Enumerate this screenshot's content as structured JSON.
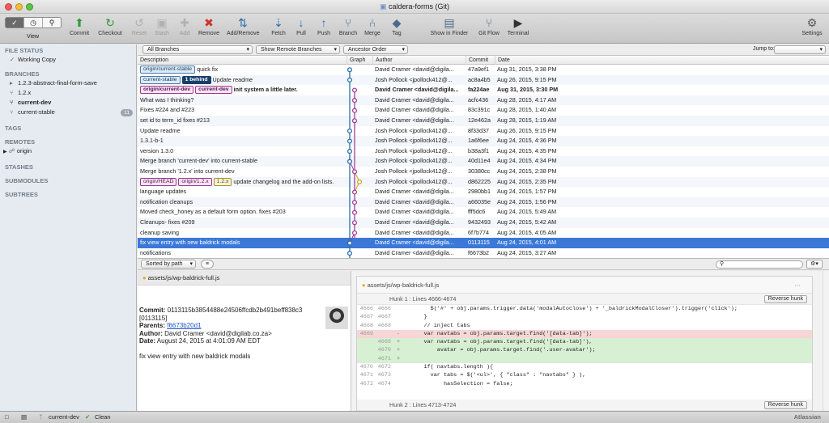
{
  "window": {
    "title": "caldera-forms (Git)"
  },
  "toolbar": {
    "view_label": "View",
    "buttons": [
      {
        "label": "Commit",
        "icon": "commit-icon",
        "enabled": true
      },
      {
        "label": "Checkout",
        "icon": "checkout-icon",
        "enabled": true
      },
      {
        "label": "Reset",
        "icon": "reset-icon",
        "enabled": false
      },
      {
        "label": "Stash",
        "icon": "stash-icon",
        "enabled": false
      },
      {
        "label": "Add",
        "icon": "add-icon",
        "enabled": false
      },
      {
        "label": "Remove",
        "icon": "remove-icon",
        "enabled": true
      },
      {
        "label": "Add/Remove",
        "icon": "add-remove-icon",
        "enabled": true
      },
      {
        "label": "Fetch",
        "icon": "fetch-icon",
        "enabled": true
      },
      {
        "label": "Pull",
        "icon": "pull-icon",
        "enabled": true
      },
      {
        "label": "Push",
        "icon": "push-icon",
        "enabled": true
      },
      {
        "label": "Branch",
        "icon": "branch-icon",
        "enabled": true
      },
      {
        "label": "Merge",
        "icon": "merge-icon",
        "enabled": true
      },
      {
        "label": "Tag",
        "icon": "tag-icon",
        "enabled": true
      },
      {
        "label": "Show in Finder",
        "icon": "finder-icon",
        "enabled": true
      },
      {
        "label": "Git Flow",
        "icon": "git-flow-icon",
        "enabled": true
      },
      {
        "label": "Terminal",
        "icon": "terminal-icon",
        "enabled": true
      }
    ],
    "settings_label": "Settings"
  },
  "sidebar": {
    "file_status": "FILE STATUS",
    "working_copy": "Working Copy",
    "branches_header": "BRANCHES",
    "branches": [
      {
        "label": "1.2.3-abstract-final-form-save",
        "current": false,
        "count": ""
      },
      {
        "label": "1.2.x",
        "current": false,
        "count": ""
      },
      {
        "label": "current-dev",
        "current": true,
        "count": ""
      },
      {
        "label": "current-stable",
        "current": false,
        "count": "11"
      }
    ],
    "tags_header": "TAGS",
    "remotes_header": "REMOTES",
    "remote": "origin",
    "stashes_header": "STASHES",
    "submodules_header": "SUBMODULES",
    "subtrees_header": "SUBTREES"
  },
  "filters": {
    "branches": "All Branches",
    "remote_branches": "Show Remote Branches",
    "order": "Ancestor Order",
    "jump_to": "Jump to:"
  },
  "columns": {
    "description": "Description",
    "graph": "Graph",
    "author": "Author",
    "commit": "Commit",
    "date": "Date"
  },
  "commits": [
    {
      "tags": [
        {
          "t": "origin/current-stable",
          "k": "rm"
        }
      ],
      "msg": "quick fix",
      "author": "David Cramer <david@digila...",
      "hash": "47a9ef1",
      "date": "Aug 31, 2015, 3:38 PM",
      "bold": false,
      "sel": false
    },
    {
      "tags": [
        {
          "t": "current-stable",
          "k": "rm"
        },
        {
          "t": "1 behind",
          "k": "ahead"
        }
      ],
      "msg": "Update readme",
      "author": "Josh Pollock <jpollock412@...",
      "hash": "ac8a4b5",
      "date": "Aug 26, 2015, 9:15 PM",
      "bold": false,
      "sel": false
    },
    {
      "tags": [
        {
          "t": "origin/current-dev",
          "k": "lc"
        },
        {
          "t": "current-dev",
          "k": "lc"
        }
      ],
      "msg": "init system a little later.",
      "author": "David Cramer <david@digila...",
      "hash": "fa224ae",
      "date": "Aug 31, 2015, 3:30 PM",
      "bold": true,
      "sel": false
    },
    {
      "tags": [],
      "msg": "What was I thinking?",
      "author": "David Cramer <david@digila...",
      "hash": "acfc436",
      "date": "Aug 28, 2015, 4:17 AM",
      "bold": false,
      "sel": false
    },
    {
      "tags": [],
      "msg": "Fixes #224 and #223",
      "author": "David Cramer <david@digila...",
      "hash": "83c391c",
      "date": "Aug 28, 2015, 1:40 AM",
      "bold": false,
      "sel": false
    },
    {
      "tags": [],
      "msg": "set id to term_id fixes #213",
      "author": "David Cramer <david@digila...",
      "hash": "12e462a",
      "date": "Aug 28, 2015, 1:19 AM",
      "bold": false,
      "sel": false
    },
    {
      "tags": [],
      "msg": "Update readme",
      "author": "Josh Pollock <jpollock412@...",
      "hash": "8f33d37",
      "date": "Aug 26, 2015, 9:15 PM",
      "bold": false,
      "sel": false
    },
    {
      "tags": [],
      "msg": "1.3.1-b-1",
      "author": "Josh Pollock <jpollock412@...",
      "hash": "1a6f6ee",
      "date": "Aug 24, 2015, 4:36 PM",
      "bold": false,
      "sel": false
    },
    {
      "tags": [],
      "msg": "version 1.3.0",
      "author": "Josh Pollock <jpollock412@...",
      "hash": "b38a3f1",
      "date": "Aug 24, 2015, 4:35 PM",
      "bold": false,
      "sel": false
    },
    {
      "tags": [],
      "msg": "Merge branch 'current-dev' into current-stable",
      "author": "Josh Pollock <jpollock412@...",
      "hash": "40d11e4",
      "date": "Aug 24, 2015, 4:34 PM",
      "bold": false,
      "sel": false
    },
    {
      "tags": [],
      "msg": "Merge branch '1.2.x' into current-dev",
      "author": "Josh Pollock <jpollock412@...",
      "hash": "30380cc",
      "date": "Aug 24, 2015, 2:38 PM",
      "bold": false,
      "sel": false
    },
    {
      "tags": [
        {
          "t": "origin/HEAD",
          "k": "lc"
        },
        {
          "t": "origin/1.2.x",
          "k": "lc"
        },
        {
          "t": "1.2.x",
          "k": "tg"
        }
      ],
      "msg": "update changelog and the add-on lists.",
      "author": "Josh Pollock <jpollock412@...",
      "hash": "d862225",
      "date": "Aug 24, 2015, 2:35 PM",
      "bold": false,
      "sel": false
    },
    {
      "tags": [],
      "msg": "language updates",
      "author": "David Cramer <david@digila...",
      "hash": "2980bb1",
      "date": "Aug 24, 2015, 1:57 PM",
      "bold": false,
      "sel": false
    },
    {
      "tags": [],
      "msg": "notification cleanups",
      "author": "David Cramer <david@digila...",
      "hash": "a66035e",
      "date": "Aug 24, 2015, 1:56 PM",
      "bold": false,
      "sel": false
    },
    {
      "tags": [],
      "msg": "Moved check_honey as a default form option. fixes #203",
      "author": "David Cramer <david@digila...",
      "hash": "fff5dc6",
      "date": "Aug 24, 2015, 5:49 AM",
      "bold": false,
      "sel": false
    },
    {
      "tags": [],
      "msg": "Cleanups- fixes #209",
      "author": "David Cramer <david@digila...",
      "hash": "9432493",
      "date": "Aug 24, 2015, 5:42 AM",
      "bold": false,
      "sel": false
    },
    {
      "tags": [],
      "msg": "cleanup saving",
      "author": "David Cramer <david@digila...",
      "hash": "6f7b774",
      "date": "Aug 24, 2015, 4:05 AM",
      "bold": false,
      "sel": false
    },
    {
      "tags": [],
      "msg": "fix view entry with new baldrick modals",
      "author": "David Cramer <david@digila...",
      "hash": "0113115",
      "date": "Aug 24, 2015, 4:01 AM",
      "bold": false,
      "sel": true
    },
    {
      "tags": [],
      "msg": "notifications",
      "author": "David Cramer <david@digila...",
      "hash": "f6673b2",
      "date": "Aug 24, 2015, 3:27 AM",
      "bold": false,
      "sel": false
    }
  ],
  "lower": {
    "sorted": "Sorted by path"
  },
  "files": [
    {
      "path": "assets/js/wp-baldrick-full.js"
    }
  ],
  "commit_detail": {
    "commit_label": "Commit:",
    "commit_value": "0113115b3854488e24506ffcdb2b491beff838c3 [0113115]",
    "parents_label": "Parents:",
    "parents_value": "f6673b20d1",
    "author_label": "Author:",
    "author_value": "David Cramer <david@digilab.co.za>",
    "date_label": "Date:",
    "date_value": "August 24, 2015 at 4:01:09 AM EDT",
    "message": "fix view entry with new baldrick modals"
  },
  "diff": {
    "file": "assets/js/wp-baldrick-full.js",
    "reverse_label": "Reverse hunk",
    "hunk1": "Hunk 1 : Lines 4666-4674",
    "hunk2": "Hunk 2 : Lines 4713-4724",
    "lines": [
      {
        "o": "4666",
        "n": "4666",
        "m": "",
        "k": "ctx",
        "code": "        $('#' + obj.params.trigger.data('modalAutoclose') + '_baldrickModalCloser').trigger('click');"
      },
      {
        "o": "4667",
        "n": "4667",
        "m": "",
        "k": "ctx",
        "code": "      }"
      },
      {
        "o": "4668",
        "n": "4668",
        "m": "",
        "k": "ctx",
        "code": "      // inject tabs"
      },
      {
        "o": "4669",
        "n": "",
        "m": "-",
        "k": "del",
        "code": "      var navtabs = obj.params.target.find('[data-tab]');"
      },
      {
        "o": "",
        "n": "4669",
        "m": "+",
        "k": "add",
        "code": "      var navtabs = obj.params.target.find('[data-tab]'),"
      },
      {
        "o": "",
        "n": "4670",
        "m": "+",
        "k": "add",
        "code": "          avatar = obj.params.target.find('.user-avatar');"
      },
      {
        "o": "",
        "n": "4671",
        "m": "+",
        "k": "add",
        "code": ""
      },
      {
        "o": "4670",
        "n": "4672",
        "m": "",
        "k": "ctx",
        "code": "      if( navtabs.length ){"
      },
      {
        "o": "4671",
        "n": "4673",
        "m": "",
        "k": "ctx",
        "code": "        var tabs = $('<ul>', { \"class\" : \"navtabs\" } ),"
      },
      {
        "o": "4672",
        "n": "4674",
        "m": "",
        "k": "ctx",
        "code": "            hasSelection = false;"
      }
    ]
  },
  "status": {
    "branch": "current-dev",
    "state": "Clean",
    "brand": "Atlassian"
  },
  "colors": {
    "selected": "#3b78d8",
    "remote": "#4a7aa6",
    "local": "#a33593",
    "tag": "#a79438"
  },
  "graph": {
    "lanes": [
      "#2b6fa8",
      "#a0409a",
      "#c8a623"
    ],
    "node_lane": [
      0,
      0,
      1,
      1,
      1,
      1,
      0,
      0,
      0,
      0,
      1,
      2,
      1,
      1,
      1,
      1,
      1,
      0,
      0
    ]
  }
}
